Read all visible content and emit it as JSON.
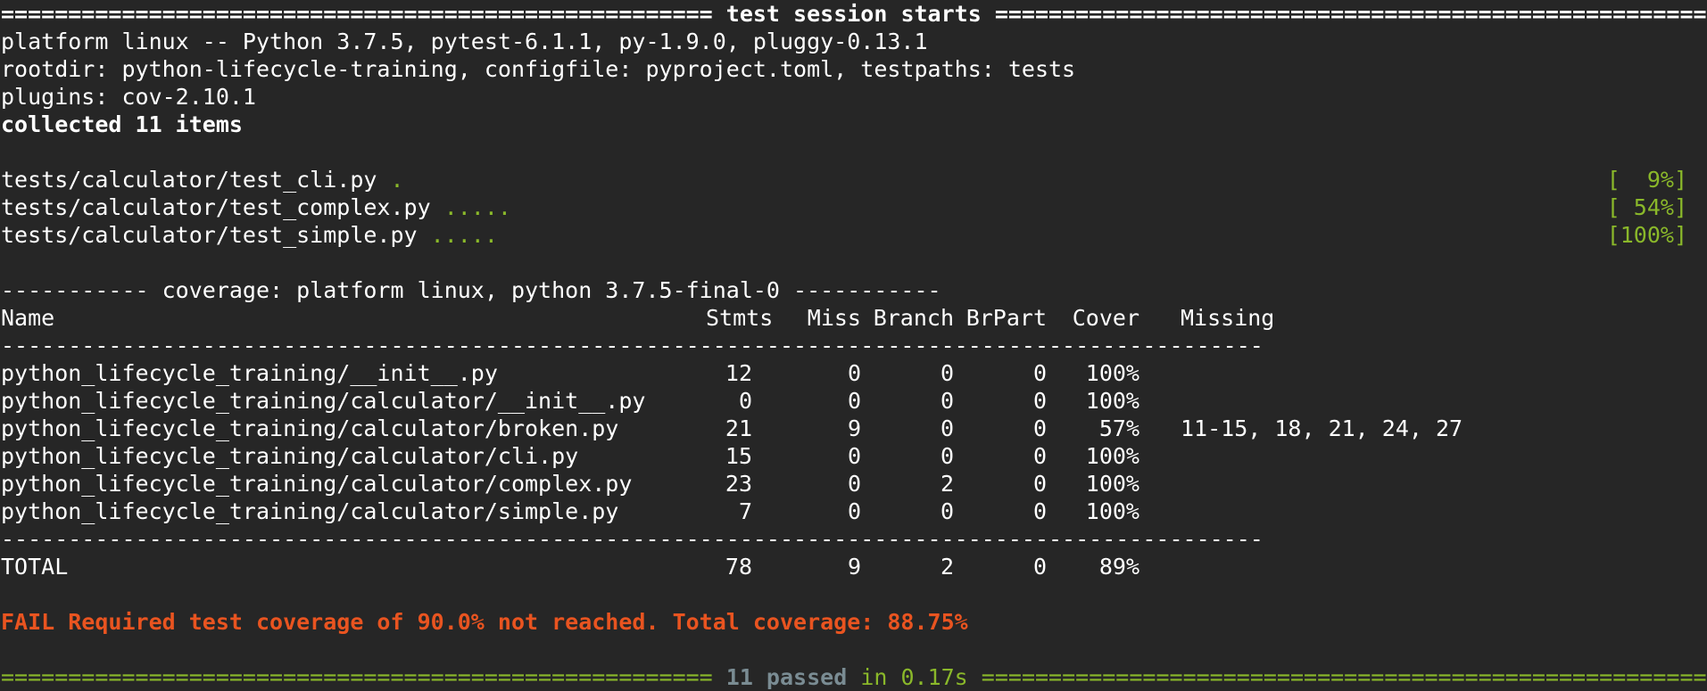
{
  "header": {
    "left_rule": "=====================================================",
    "title": "test session starts",
    "right_rule": "========================================================"
  },
  "platform_line": "platform linux -- Python 3.7.5, pytest-6.1.1, py-1.9.0, pluggy-0.13.1",
  "rootdir_line": "rootdir: python-lifecycle-training, configfile: pyproject.toml, testpaths: tests",
  "plugins_line": "plugins: cov-2.10.1",
  "collected_line": "collected 11 items",
  "tests": [
    {
      "file": "tests/calculator/test_cli.py",
      "dots": ".",
      "progress": "[  9%]"
    },
    {
      "file": "tests/calculator/test_complex.py",
      "dots": ".....",
      "progress": "[ 54%]"
    },
    {
      "file": "tests/calculator/test_simple.py",
      "dots": ".....",
      "progress": "[100%]"
    }
  ],
  "coverage_header": "----------- coverage: platform linux, python 3.7.5-final-0 -----------",
  "table": {
    "columns": [
      "Name",
      "Stmts",
      "Miss",
      "Branch",
      "BrPart",
      "Cover",
      "Missing"
    ],
    "separator": "----------------------------------------------------------------------------------------------",
    "rows": [
      {
        "name": "python_lifecycle_training/__init__.py",
        "stmts": "12",
        "miss": "0",
        "branch": "0",
        "brpart": "0",
        "cover": "100%",
        "missing": ""
      },
      {
        "name": "python_lifecycle_training/calculator/__init__.py",
        "stmts": "0",
        "miss": "0",
        "branch": "0",
        "brpart": "0",
        "cover": "100%",
        "missing": ""
      },
      {
        "name": "python_lifecycle_training/calculator/broken.py",
        "stmts": "21",
        "miss": "9",
        "branch": "0",
        "brpart": "0",
        "cover": "57%",
        "missing": "11-15, 18, 21, 24, 27"
      },
      {
        "name": "python_lifecycle_training/calculator/cli.py",
        "stmts": "15",
        "miss": "0",
        "branch": "0",
        "brpart": "0",
        "cover": "100%",
        "missing": ""
      },
      {
        "name": "python_lifecycle_training/calculator/complex.py",
        "stmts": "23",
        "miss": "0",
        "branch": "2",
        "brpart": "0",
        "cover": "100%",
        "missing": ""
      },
      {
        "name": "python_lifecycle_training/calculator/simple.py",
        "stmts": "7",
        "miss": "0",
        "branch": "0",
        "brpart": "0",
        "cover": "100%",
        "missing": ""
      }
    ],
    "total": {
      "name": "TOTAL",
      "stmts": "78",
      "miss": "9",
      "branch": "2",
      "brpart": "0",
      "cover": "89%"
    }
  },
  "fail_message": "FAIL Required test coverage of 90.0% not reached. Total coverage: 88.75%",
  "footer": {
    "left_rule": "=====================================================",
    "count": "11 passed",
    "time": "in 0.17s",
    "right_rule": "========================================================"
  },
  "colors": {
    "background": "#262626",
    "pass_green": "#8ab82a",
    "fail_red": "#e95420",
    "text": "#ffffff"
  }
}
